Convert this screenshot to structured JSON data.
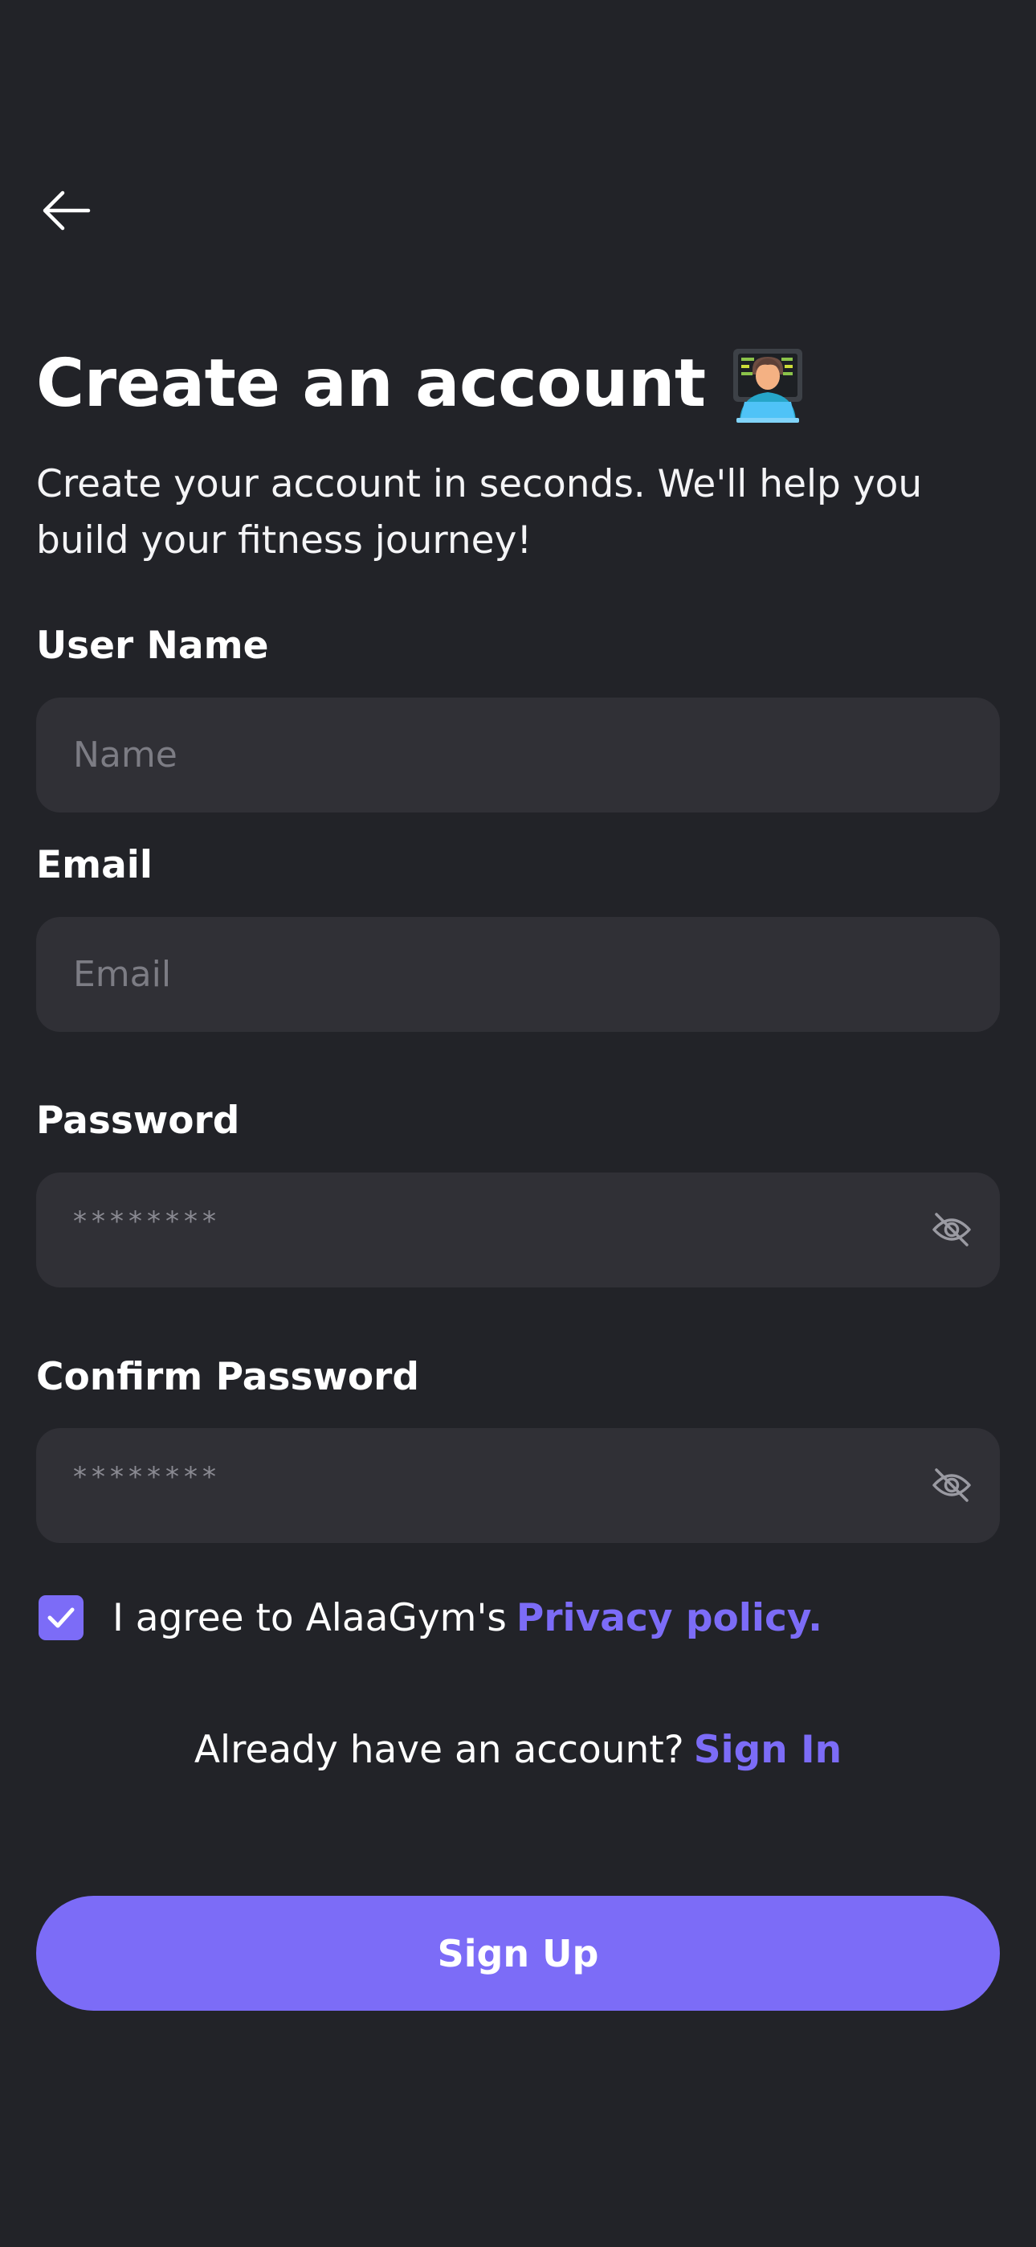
{
  "header": {
    "back_icon": "arrow-left-icon",
    "title": "Create an account",
    "title_emoji_icon": "technologist-emoji-icon",
    "subtitle": "Create your account in seconds. We'll help you build your fitness journey!"
  },
  "form": {
    "username": {
      "label": "User Name",
      "placeholder": "Name",
      "value": ""
    },
    "email": {
      "label": "Email",
      "placeholder": "Email",
      "value": ""
    },
    "password": {
      "label": "Password",
      "placeholder": "********",
      "value": "",
      "toggle_icon": "eye-off-icon"
    },
    "confirm_password": {
      "label": "Confirm Password",
      "placeholder": "********",
      "value": "",
      "toggle_icon": "eye-off-icon"
    }
  },
  "agreement": {
    "checked": true,
    "check_icon": "checkmark-icon",
    "text": "I agree to AlaaGym's",
    "link_label": "Privacy policy."
  },
  "signin": {
    "prompt": "Already have an account?",
    "link_label": "Sign In"
  },
  "submit": {
    "label": "Sign Up"
  },
  "colors": {
    "background": "#222328",
    "input_background": "#303036",
    "accent": "#7c6cf7",
    "placeholder": "#7c7c84"
  }
}
